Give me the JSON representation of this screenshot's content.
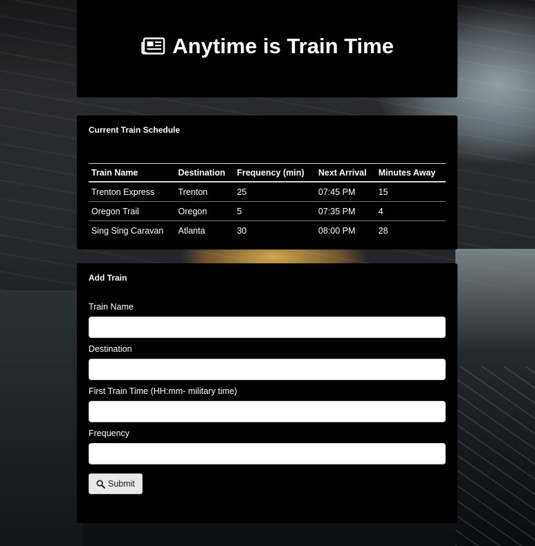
{
  "header": {
    "icon": "newspaper-icon",
    "title": "Anytime is Train Time"
  },
  "schedule": {
    "title": "Current Train Schedule",
    "columns": [
      "Train Name",
      "Destination",
      "Frequency (min)",
      "Next Arrival",
      "Minutes Away"
    ],
    "rows": [
      [
        "Trenton Express",
        "Trenton",
        "25",
        "07:45 PM",
        "15"
      ],
      [
        "Oregon Trail",
        "Oregon",
        "5",
        "07:35 PM",
        "4"
      ],
      [
        "Sing Sing Caravan",
        "Atlanta",
        "30",
        "08:00 PM",
        "28"
      ]
    ]
  },
  "add_train": {
    "title": "Add Train",
    "fields": [
      {
        "label": "Train Name",
        "value": ""
      },
      {
        "label": "Destination",
        "value": ""
      },
      {
        "label": "First Train Time (HH:mm- military time)",
        "value": ""
      },
      {
        "label": "Frequency",
        "value": ""
      }
    ],
    "submit_label": "Submit",
    "submit_icon": "search-icon"
  }
}
